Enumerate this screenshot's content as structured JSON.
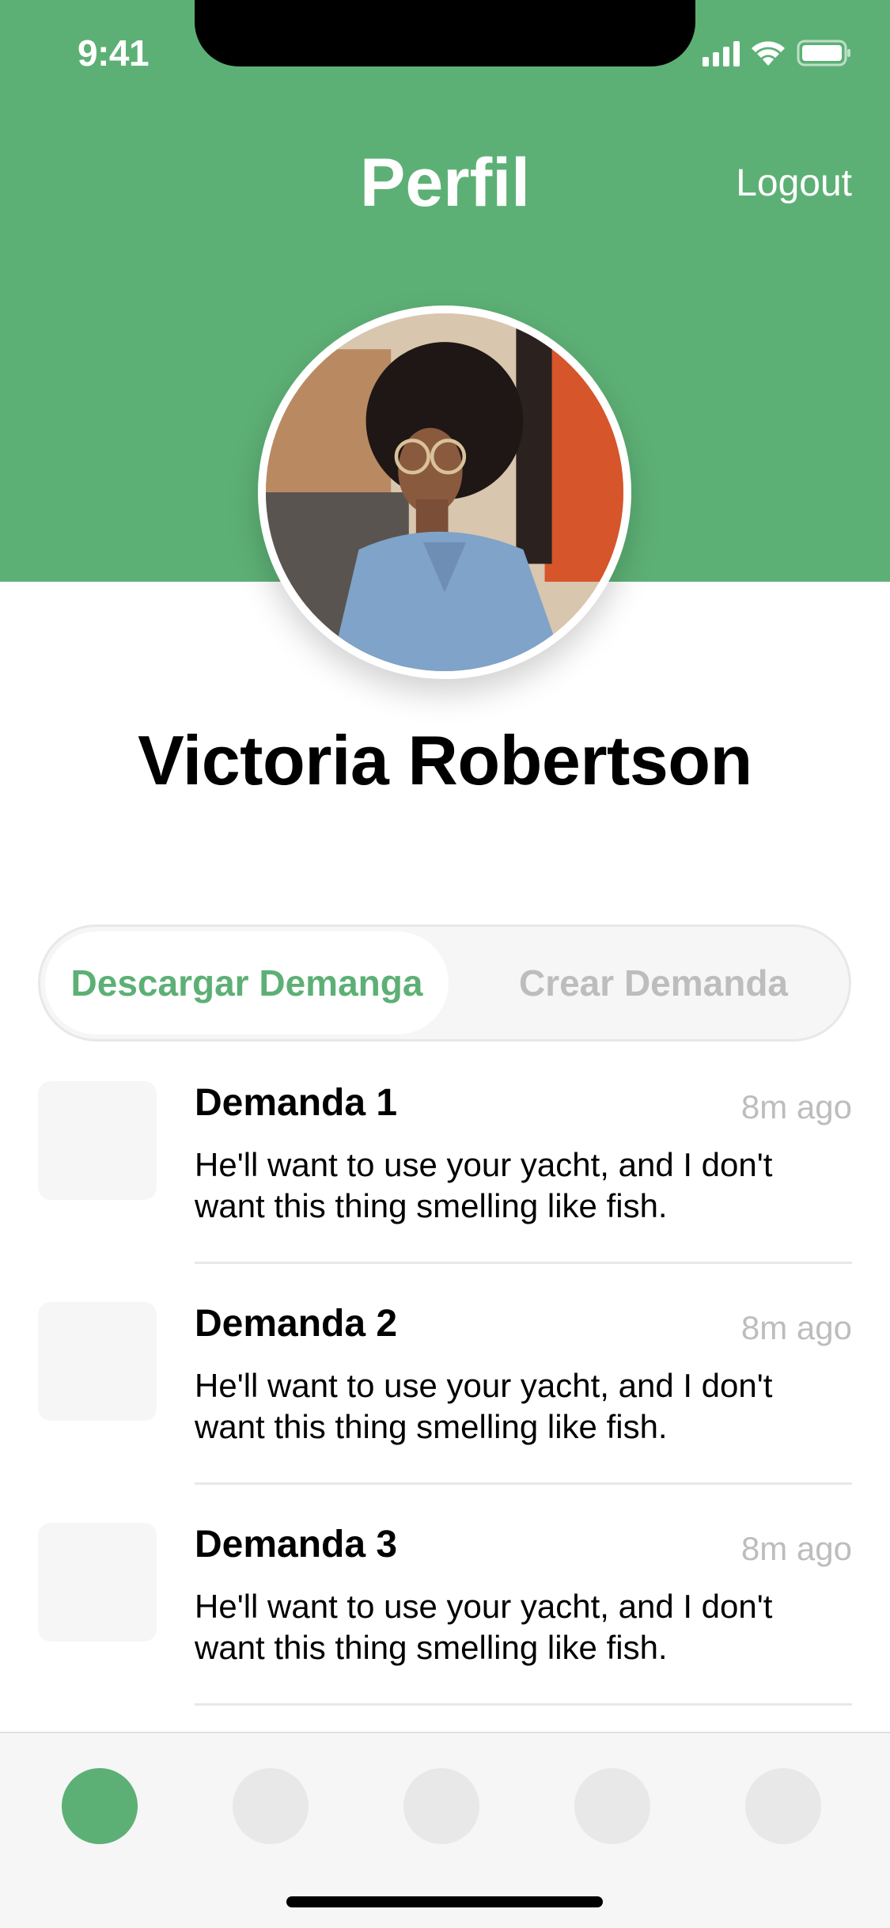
{
  "status_bar": {
    "time": "9:41"
  },
  "header": {
    "title": "Perfil",
    "logout_label": "Logout",
    "background_color": "#5DB075"
  },
  "profile": {
    "name": "Victoria Robertson"
  },
  "segmented_control": {
    "segments": [
      {
        "label": "Descargar Demanga",
        "active": true
      },
      {
        "label": "Crear Demanda",
        "active": false
      }
    ]
  },
  "list": {
    "items": [
      {
        "title": "Demanda 1",
        "time": "8m ago",
        "body": "He'll want to use your yacht, and I don't want this thing smelling like fish."
      },
      {
        "title": "Demanda 2",
        "time": "8m ago",
        "body": "He'll want to use your yacht, and I don't want this thing smelling like fish."
      },
      {
        "title": "Demanda 3",
        "time": "8m ago",
        "body": "He'll want to use your yacht, and I don't want this thing smelling like fish."
      }
    ]
  },
  "tab_bar": {
    "tabs": [
      {
        "icon": "tab-1-icon",
        "active": true
      },
      {
        "icon": "tab-2-icon",
        "active": false
      },
      {
        "icon": "tab-3-icon",
        "active": false
      },
      {
        "icon": "tab-4-icon",
        "active": false
      },
      {
        "icon": "tab-5-icon",
        "active": false
      }
    ],
    "accent_color": "#5DB075"
  }
}
